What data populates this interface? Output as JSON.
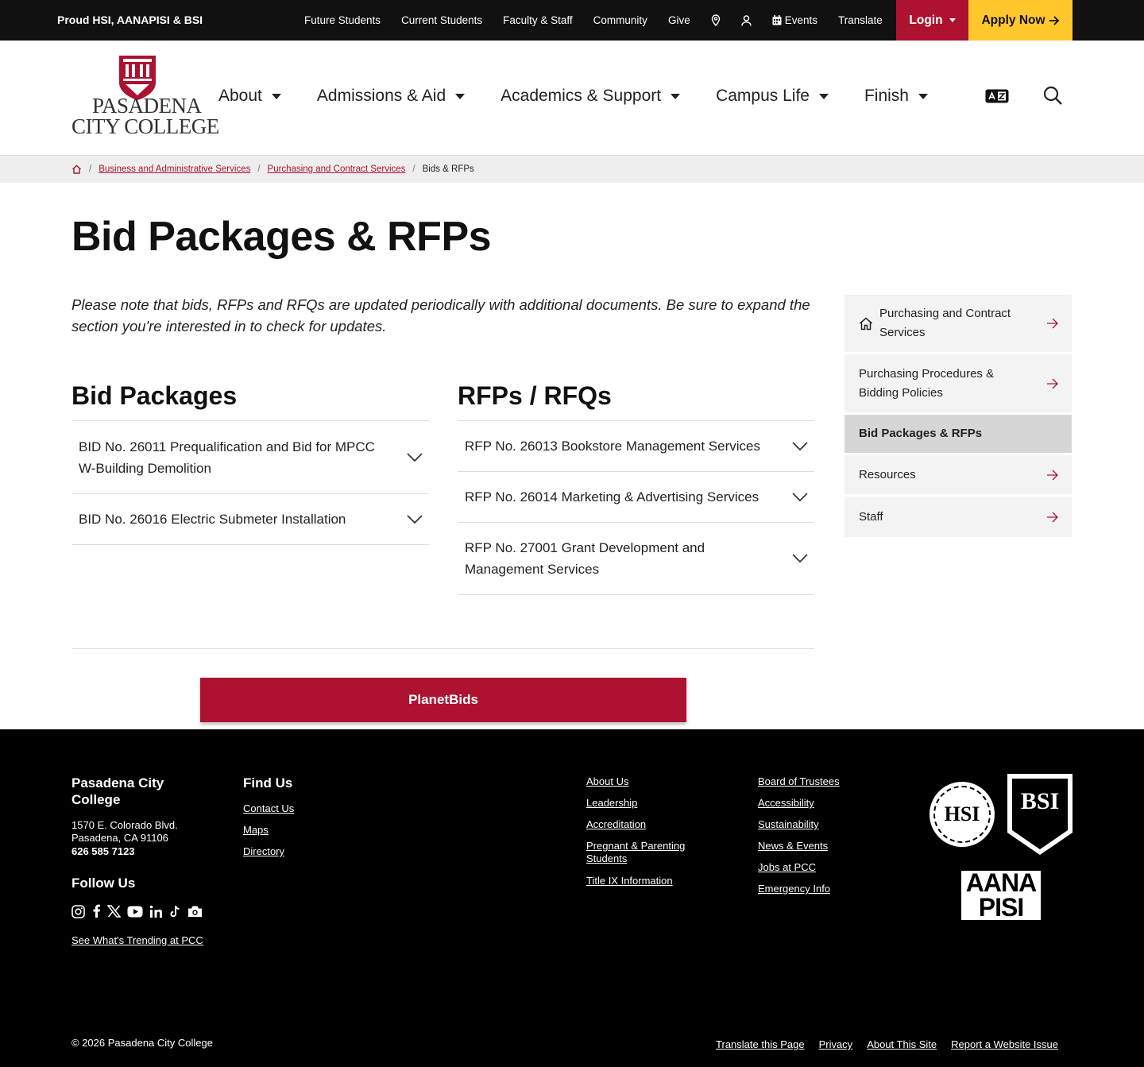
{
  "utility": {
    "proud": "Proud HSI, AANAPISI & BSI",
    "links": [
      "Future Students",
      "Current Students",
      "Faculty & Staff",
      "Community",
      "Give"
    ],
    "events": "Events",
    "translate": "Translate",
    "login": "Login",
    "apply": "Apply Now"
  },
  "logo": {
    "line1": "PASADENA",
    "line2": "CITY COLLEGE"
  },
  "nav": [
    "About",
    "Admissions & Aid",
    "Academics & Support",
    "Campus Life",
    "Finish"
  ],
  "breadcrumb": {
    "links": [
      "Business and Administrative Services",
      "Purchasing and Contract Services"
    ],
    "current": "Bids & RFPs"
  },
  "page": {
    "title": "Bid Packages & RFPs",
    "note": "Please note that bids, RFPs and RFQs are updated periodically with additional documents. Be sure to expand the section you're interested in to check for updates."
  },
  "bids": {
    "heading": "Bid Packages",
    "items": [
      "BID No. 26011 Prequalification and Bid for MPCC W-Building Demolition",
      "BID No. 26016 Electric Submeter Installation"
    ]
  },
  "rfps": {
    "heading": "RFPs / RFQs",
    "items": [
      "RFP No. 26013 Bookstore Management Services",
      "RFP No. 26014 Marketing & Advertising Services",
      "RFP No. 27001 Grant Development and Management Services"
    ]
  },
  "planetbids": "PlanetBids",
  "sidenav": [
    "Purchasing and Contract Services",
    "Purchasing Procedures & Bidding Policies",
    "Bid Packages & RFPs",
    "Resources",
    "Staff"
  ],
  "footer": {
    "name": "Pasadena City College",
    "address1": "1570 E. Colorado Blvd.",
    "address2": "Pasadena, CA 91106",
    "phone": "626 585 7123",
    "follow": "Follow Us",
    "trending": "See What's Trending at PCC",
    "findus": "Find Us",
    "findlinks": [
      "Contact Us",
      "Maps",
      "Directory"
    ],
    "col3": [
      "About Us",
      "Leadership",
      "Accreditation",
      "Pregnant & Parenting Students",
      "Title IX Information"
    ],
    "col4": [
      "Board of Trustees",
      "Accessibility",
      "Sustainability",
      "News & Events",
      "Jobs at PCC",
      "Emergency Info"
    ],
    "copyright": "© 2026 Pasadena City College",
    "bottomlinks": [
      "Translate this Page",
      "Privacy",
      "About This Site",
      "Report a Website Issue"
    ],
    "badges": {
      "hsi": "HSI",
      "bsi": "BSI",
      "aana": "AANA",
      "pisi": "PISI"
    }
  },
  "colors": {
    "brand_red": "#ad1230",
    "apply_yellow": "#ffc72c",
    "footer_bg": "#000000"
  }
}
